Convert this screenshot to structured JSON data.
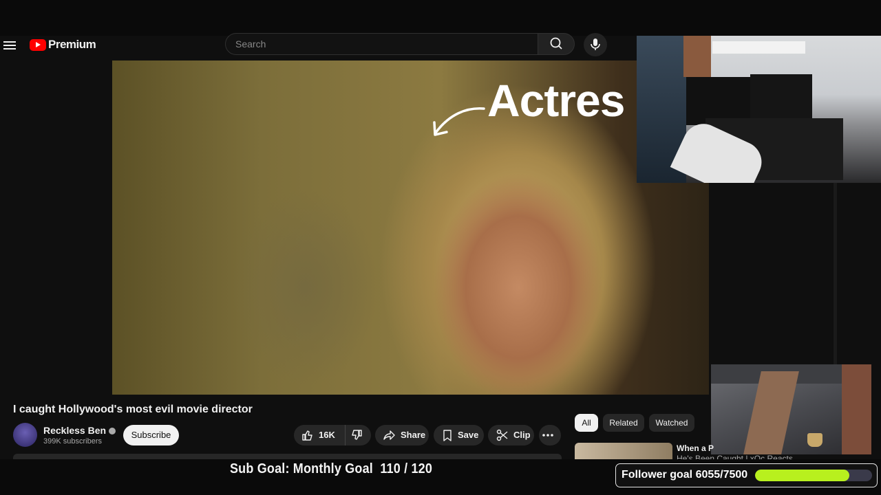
{
  "header": {
    "logo_text": "Premium",
    "search_placeholder": "Search"
  },
  "video": {
    "overlay_text": "Actres",
    "title": "I caught Hollywood's most evil movie director"
  },
  "channel": {
    "name": "Reckless Ben",
    "subscribers": "399K subscribers",
    "subscribe_label": "Subscribe"
  },
  "actions": {
    "likes": "16K",
    "share_label": "Share",
    "save_label": "Save",
    "clip_label": "Clip"
  },
  "chips": [
    "All",
    "Related",
    "Watched"
  ],
  "recommendation": {
    "title": "When a P",
    "subtitle": "He's Been Caught | xQc Reacts"
  },
  "overlay": {
    "sub_goal_text": "Sub Goal: Monthly Goal  110 / 120",
    "follower_goal_text": "Follower goal 6055/7500",
    "follower_progress": 0.807
  },
  "colors": {
    "accent_red": "#ff0000",
    "progress_green": "#b8f01e"
  }
}
